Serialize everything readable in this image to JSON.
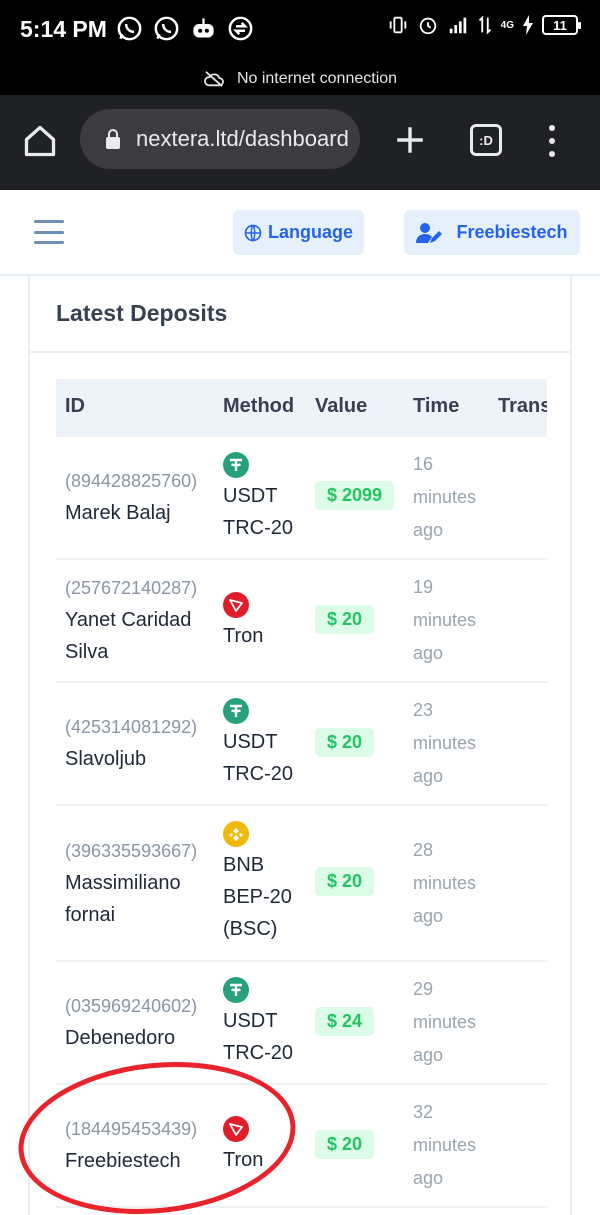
{
  "status_bar": {
    "time": "5:14 PM",
    "apps": [
      "whatsapp-icon",
      "whatsapp-business-icon",
      "robot-app-icon",
      "sync-app-icon"
    ],
    "network": "4G",
    "battery": "11"
  },
  "offline_banner": {
    "text": "No internet connection"
  },
  "browser": {
    "url": "nextera.ltd/dashboard"
  },
  "header": {
    "language_label": "Language",
    "user_label": "Freebiestech"
  },
  "card": {
    "title": "Latest Deposits",
    "columns": {
      "id": "ID",
      "method": "Method",
      "value": "Value",
      "time": "Time",
      "trans": "Trans"
    },
    "rows": [
      {
        "tx": "(894428825760)",
        "name": "Marek Balaj",
        "coin": "usdt",
        "method": "USDT TRC-20",
        "value": "$ 2099",
        "time": "16 minutes ago"
      },
      {
        "tx": "(257672140287)",
        "name": "Yanet Caridad Silva",
        "coin": "tron",
        "method": "Tron",
        "value": "$ 20",
        "time": "19 minutes ago"
      },
      {
        "tx": "(425314081292)",
        "name": "Slavoljub",
        "coin": "usdt",
        "method": "USDT TRC-20",
        "value": "$ 20",
        "time": "23 minutes ago"
      },
      {
        "tx": "(396335593667)",
        "name": "Massimiliano fornai",
        "coin": "bnb",
        "method": "BNB BEP-20 (BSC)",
        "value": "$ 20",
        "time": "28 minutes ago"
      },
      {
        "tx": "(035969240602)",
        "name": "Debenedoro",
        "coin": "usdt",
        "method": "USDT TRC-20",
        "value": "$ 24",
        "time": "29 minutes ago"
      },
      {
        "tx": "(184495453439)",
        "name": "Freebiestech",
        "coin": "tron",
        "method": "Tron",
        "value": "$ 20",
        "time": "32 minutes ago"
      }
    ]
  },
  "colors": {
    "accent": "#2563eb",
    "badge_bg": "#dcfce7",
    "badge_text": "#22c55e",
    "annotation": "#e8232b"
  }
}
